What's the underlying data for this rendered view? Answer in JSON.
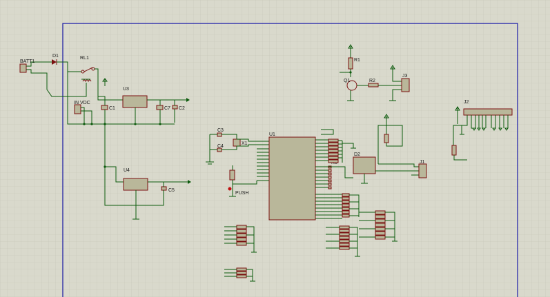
{
  "schematic": {
    "border_color": "#1c1ca8",
    "grid_color": "#c4c4b6",
    "wire_color": "#0c5a0c",
    "component_body_color": "#b9b79a",
    "component_outline_color": "#7a1010",
    "labels": {
      "batt": "BATT1",
      "d1": "D1",
      "rl1": "RL1",
      "in_vdc": "IN VDC",
      "u3": "U3",
      "u4": "U4",
      "c1": "C1",
      "c7": "C7",
      "c2": "C2",
      "c5": "C5",
      "c3": "C3",
      "c4": "C4",
      "x1": "X1",
      "u1": "U1",
      "push": "PUSH",
      "r1": "R1",
      "r2": "R2",
      "q1": "Q1",
      "j3": "J3",
      "j2": "J2",
      "d2": "D2",
      "j1": "J1",
      "r3": "R3"
    }
  }
}
